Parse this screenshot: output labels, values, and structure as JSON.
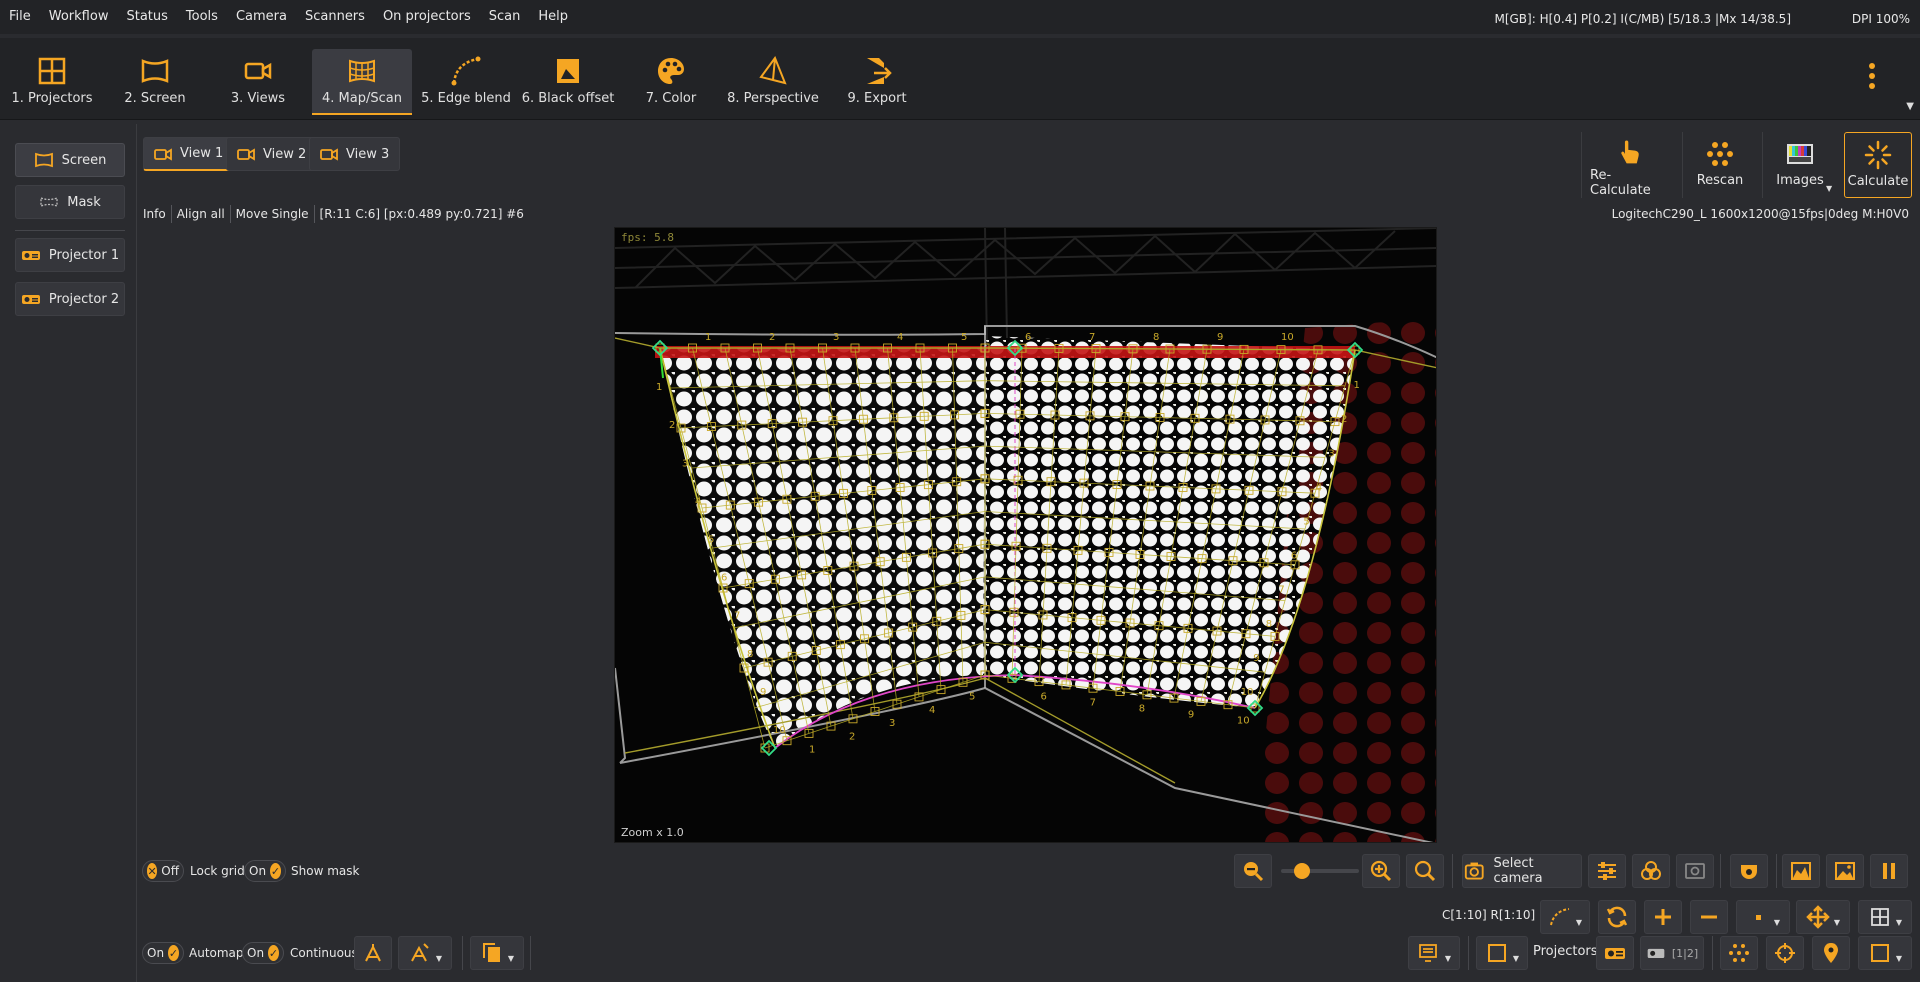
{
  "menu": [
    "File",
    "Workflow",
    "Status",
    "Tools",
    "Camera",
    "Scanners",
    "On projectors",
    "Scan",
    "Help"
  ],
  "status_text": "M[GB]: H[0.4] P[0.2] I(C/MB) [5/18.3 |Mx 14/38.5]",
  "dpi_text": "DPI 100%",
  "toolbar": {
    "items": [
      {
        "label": "1. Projectors",
        "icon": "grid-icon"
      },
      {
        "label": "2. Screen",
        "icon": "screen-icon"
      },
      {
        "label": "3. Views",
        "icon": "camera-icon"
      },
      {
        "label": "4. Map/Scan",
        "icon": "mapscan-icon",
        "active": true
      },
      {
        "label": "5. Edge blend",
        "icon": "curve-icon"
      },
      {
        "label": "6. Black offset",
        "icon": "black-offset-icon"
      },
      {
        "label": "7. Color",
        "icon": "palette-icon"
      },
      {
        "label": "8. Perspective",
        "icon": "perspective-icon"
      },
      {
        "label": "9. Export",
        "icon": "export-icon"
      }
    ]
  },
  "left_panel": {
    "screen_label": "Screen",
    "mask_label": "Mask",
    "projector1_label": "Projector 1",
    "projector2_label": "Projector 2"
  },
  "views": [
    "View 1",
    "View 2",
    "View 3"
  ],
  "actions": {
    "recalc": "Re-Calculate",
    "rescan": "Rescan",
    "images": "Images",
    "calculate": "Calculate"
  },
  "info_line": {
    "info": "Info",
    "align_all": "Align all",
    "move_single": "Move Single",
    "coords": "[R:11 C:6] [px:0.489 py:0.721] #6"
  },
  "camera_info": "LogitechC290_L 1600x1200@15fps|0deg M:H0V0",
  "viewport": {
    "fps": "fps: 5.8",
    "zoom": "Zoom x 1.0",
    "col_labels": [
      "1",
      "2",
      "3",
      "4",
      "5",
      "6",
      "7",
      "8",
      "9",
      "10"
    ],
    "row_labels": [
      "1",
      "2",
      "3",
      "4",
      "5",
      "6",
      "7",
      "8",
      "9",
      "10"
    ]
  },
  "bottom": {
    "lock_grid_state": "Off",
    "lock_grid_label": "Lock grid",
    "show_mask_state": "On",
    "show_mask_label": "Show mask",
    "automap_state": "On",
    "automap_label": "Automap",
    "continuous_state": "On",
    "continuous_label": "Continuous",
    "select_camera": "Select camera",
    "grid_info": "C[1:10] R[1:10]",
    "projectors_label": "Projectors",
    "projector_count": "[1|2]"
  },
  "colors": {
    "accent": "#f5a623",
    "bg": "#2a2b2f",
    "bar": "#222326"
  }
}
